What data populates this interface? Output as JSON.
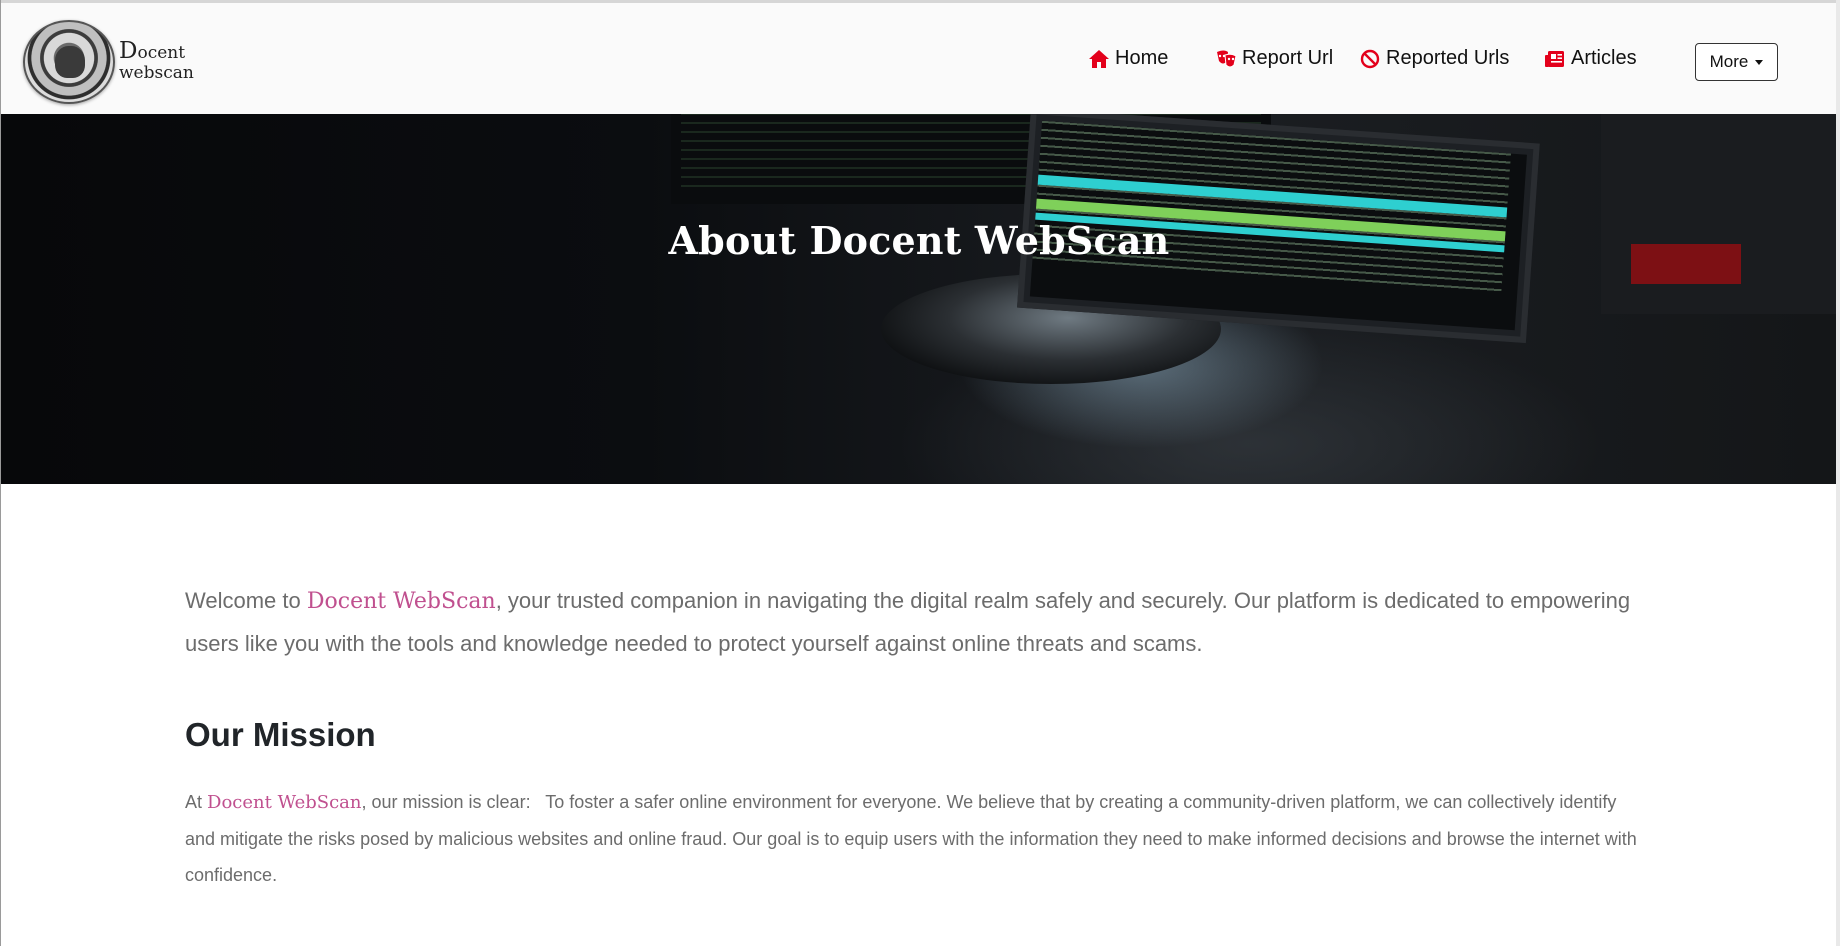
{
  "brand": {
    "name_line1_cap": "D",
    "name_line1_rest": "ocent",
    "name_line2": "webscan"
  },
  "nav": {
    "items": [
      {
        "label": "Home",
        "icon": "home-icon"
      },
      {
        "label": "Report Url",
        "icon": "report-mask-icon"
      },
      {
        "label": "Reported Urls",
        "icon": "ban-icon"
      },
      {
        "label": "Articles",
        "icon": "newspaper-icon"
      }
    ],
    "more_label": "More"
  },
  "hero": {
    "title": "About Docent WebScan"
  },
  "intro": {
    "prefix": "Welcome to ",
    "brand": "Docent WebScan",
    "suffix": ", your trusted companion in navigating the digital realm safely and securely. Our platform is dedicated to empowering users like you with the tools and knowledge needed to protect yourself against online threats and scams."
  },
  "mission": {
    "title": "Our Mission",
    "prefix": "At ",
    "brand": "Docent WebScan",
    "suffix": ", our mission is clear:   To foster a safer online environment for everyone. We believe that by creating a community-driven platform, we can collectively identify and mitigate the risks posed by malicious websites and online fraud. Our goal is to equip users with the information they need to make informed decisions and browse the internet with confidence."
  },
  "colors": {
    "accent_pink": "#c0508f",
    "nav_icon_red": "#e3001b",
    "body_text": "#6c6c6c"
  }
}
